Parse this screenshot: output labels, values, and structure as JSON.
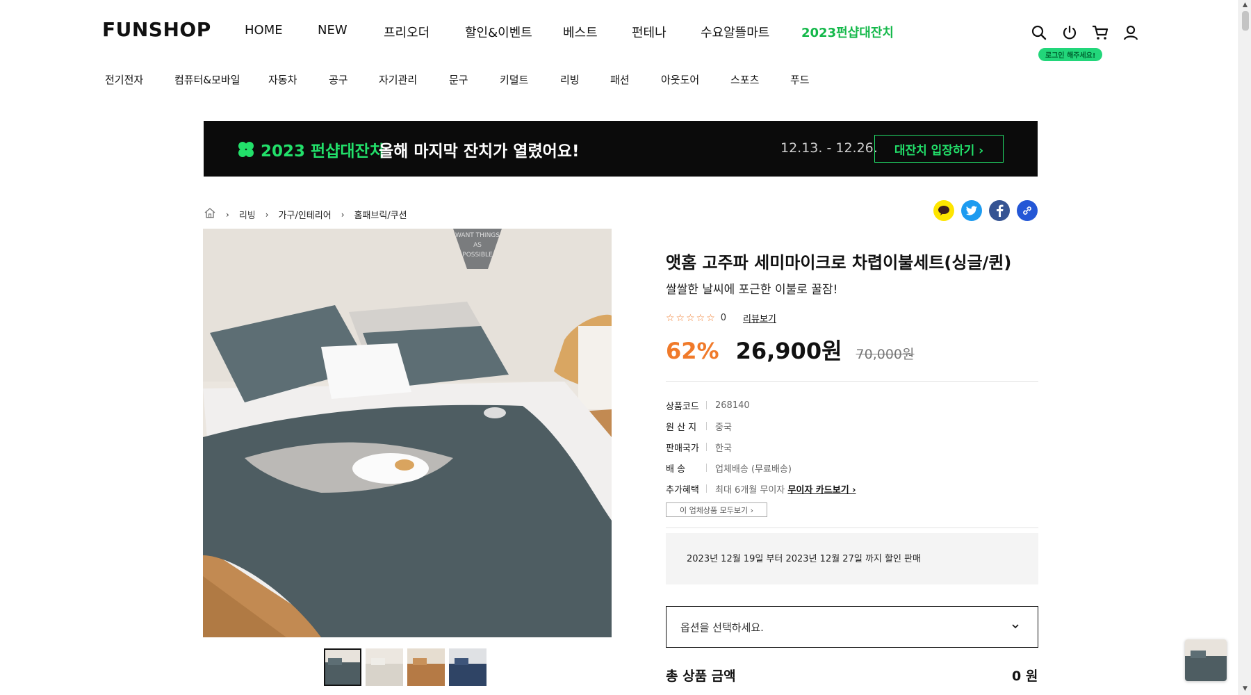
{
  "header": {
    "logo": "FUNSHOP",
    "main_nav": [
      {
        "label": "HOME"
      },
      {
        "label": "NEW"
      },
      {
        "label": "프리오더"
      },
      {
        "label": "할인&이벤트"
      },
      {
        "label": "베스트"
      },
      {
        "label": "펀테나"
      },
      {
        "label": "수요알뜰마트"
      },
      {
        "label": "2023펀샵대잔치"
      }
    ],
    "icons": [
      "search-icon",
      "power-icon",
      "cart-icon",
      "user-icon"
    ],
    "login_badge": "로그인 해주세요!",
    "category_nav": [
      {
        "label": "전기전자"
      },
      {
        "label": "컴퓨터&모바일"
      },
      {
        "label": "자동차"
      },
      {
        "label": "공구"
      },
      {
        "label": "자기관리"
      },
      {
        "label": "문구"
      },
      {
        "label": "키덜트"
      },
      {
        "label": "리빙"
      },
      {
        "label": "패션"
      },
      {
        "label": "아웃도어"
      },
      {
        "label": "스포츠"
      },
      {
        "label": "푸드"
      }
    ]
  },
  "banner": {
    "title": "2023 펀샵대잔치",
    "text": "올해 마지막 잔치가 열렸어요!",
    "date": "12.13. - 12.26.",
    "button": "대잔치 입장하기 ›"
  },
  "breadcrumb": {
    "home_icon": "home-icon",
    "items": [
      "리빙",
      "가구/인테리어",
      "홈패브릭/쿠션"
    ]
  },
  "share": [
    "kakaotalk-icon",
    "twitter-icon",
    "facebook-icon",
    "link-icon"
  ],
  "product": {
    "title": "앳홈 고주파 세미마이크로 차렵이불세트(싱글/퀸)",
    "subtitle": "쌀쌀한 날씨에 포근한 이불로 꿀잠!",
    "stars": "☆☆☆☆☆",
    "rating_count": "0",
    "review_link": "리뷰보기",
    "discount": "62%",
    "price": "26,900원",
    "original_price": "70,000원",
    "info": [
      {
        "key": "상품코드",
        "value": "268140"
      },
      {
        "key": "원 산 지",
        "value": "중국"
      },
      {
        "key": "판매국가",
        "value": "한국"
      },
      {
        "key": "배 송",
        "value": "업체배송 (무료배송)"
      },
      {
        "key": "추가혜택",
        "value": "최대 6개월 무이자",
        "link": "무이자 카드보기 ›"
      }
    ],
    "vendor_button": "이 업체상품 모두보기 ›",
    "notice": "2023년 12월 19일 부터 2023년 12월 27일 까지 할인 판매",
    "option_placeholder": "옵션을 선택하세요.",
    "total_label": "총 상품 금액",
    "total_value": "0 원",
    "image_sign_text": "WANT THINGS AS POSSIBLE",
    "thumbnail_count": 4
  },
  "colors": {
    "accent_green": "#22e06a",
    "discount_orange": "#f07a2a",
    "banner_bg": "#0b0b0b"
  }
}
